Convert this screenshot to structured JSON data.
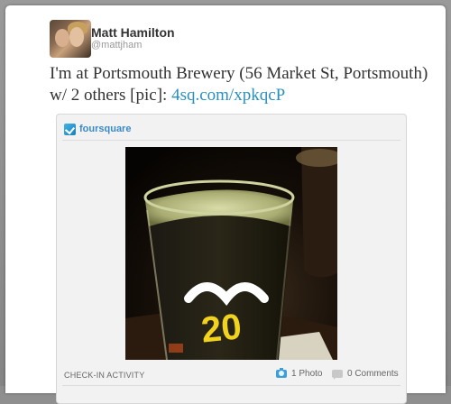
{
  "tweet": {
    "author_name": "Matt Hamilton",
    "author_handle": "@mattjham",
    "text": "I'm at Portsmouth Brewery (56 Market St, Portsmouth) w/ 2 others [pic]: ",
    "link_text": "4sq.com/xpkqcP"
  },
  "media": {
    "source_label": "foursquare",
    "source_icon": "foursquare-check-icon",
    "photo_glass_text": "20",
    "footer_label": "CHECK-IN ACTIVITY",
    "photo_count": "1 Photo",
    "comment_count": "0 Comments"
  },
  "colors": {
    "link": "#2a8fbd",
    "foursquare": "#3a8ac4"
  }
}
